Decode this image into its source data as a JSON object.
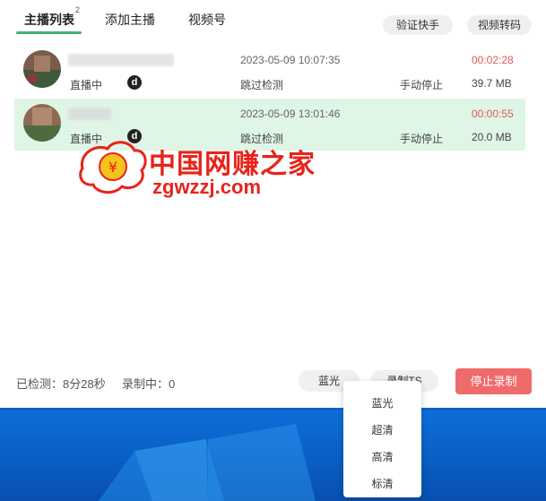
{
  "tabs": [
    {
      "label": "主播列表",
      "badge": "2"
    },
    {
      "label": "添加主播"
    },
    {
      "label": "视频号"
    }
  ],
  "header_buttons": {
    "verify": "验证快手",
    "convert": "视频转码"
  },
  "rows": [
    {
      "status": "直播中",
      "platform_icon": "d",
      "time": "2023-05-09 10:07:35",
      "detect": "跳过检测",
      "stop_mode": "手动停止",
      "duration": "00:02:28",
      "size": "39.7 MB"
    },
    {
      "status": "直播中",
      "platform_icon": "d",
      "time": "2023-05-09 13:01:46",
      "detect": "跳过检测",
      "stop_mode": "手动停止",
      "duration": "00:00:55",
      "size": "20.0 MB"
    }
  ],
  "watermark": {
    "cn": "中国网赚之家",
    "url": "zgwzzj.com"
  },
  "footer": {
    "checked_label": "已检测：",
    "checked_value": "8分28秒",
    "recording_label": "录制中：",
    "recording_value": "0",
    "quality": "蓝光",
    "format": "录制TS",
    "stop": "停止录制"
  },
  "dropdown": {
    "options": [
      "蓝光",
      "超清",
      "高清",
      "标清"
    ]
  },
  "colors": {
    "accent": "#3cb371",
    "selected_row": "#dff5e6",
    "duration": "#e05a5a",
    "stop_button": "#ef6b6b",
    "watermark": "#e8231a"
  }
}
